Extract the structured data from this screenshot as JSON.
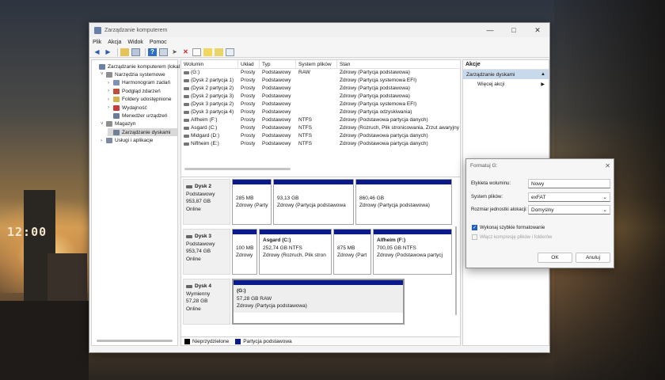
{
  "desktop": {
    "clock": "12:00"
  },
  "window": {
    "title": "Zarządzanie komputerem"
  },
  "menu": [
    "Plik",
    "Akcja",
    "Widok",
    "Pomoc"
  ],
  "tree": [
    {
      "label": "Zarządzanie komputerem (lokal",
      "indent": 0,
      "expander": "",
      "color": "#6b7fa8"
    },
    {
      "label": "Narzędzia systemowe",
      "indent": 1,
      "expander": "˅",
      "color": "#8e8e8e"
    },
    {
      "label": "Harmonogram zadań",
      "indent": 2,
      "expander": "›",
      "color": "#7b93b8"
    },
    {
      "label": "Podgląd zdarzeń",
      "indent": 2,
      "expander": "›",
      "color": "#c0503a"
    },
    {
      "label": "Foldery udostępnione",
      "indent": 2,
      "expander": "›",
      "color": "#d6b24a"
    },
    {
      "label": "Wydajność",
      "indent": 2,
      "expander": "›",
      "color": "#c83c3c"
    },
    {
      "label": "Menedżer urządzeń",
      "indent": 2,
      "expander": "",
      "color": "#6b7b9a"
    },
    {
      "label": "Magazyn",
      "indent": 1,
      "expander": "˅",
      "color": "#8e8e8e"
    },
    {
      "label": "Zarządzanie dyskami",
      "indent": 2,
      "expander": "",
      "color": "#6f7f94",
      "selected": true
    },
    {
      "label": "Usługi i aplikacje",
      "indent": 1,
      "expander": "›",
      "color": "#7d8aa4"
    }
  ],
  "volumes": {
    "headers": [
      "Wolumin",
      "Układ",
      "Typ",
      "System plików",
      "Stan"
    ],
    "rows": [
      [
        "(G:)",
        "Prosty",
        "Podstawowy",
        "RAW",
        "Zdrowy (Partycja podstawowa)"
      ],
      [
        "(Dysk 2 partycja 1)",
        "Prosty",
        "Podstawowy",
        "",
        "Zdrowy (Partycja systemowa EFI)"
      ],
      [
        "(Dysk 2 partycja 2)",
        "Prosty",
        "Podstawowy",
        "",
        "Zdrowy (Partycja podstawowa)"
      ],
      [
        "(Dysk 2 partycja 3)",
        "Prosty",
        "Podstawowy",
        "",
        "Zdrowy (Partycja podstawowa)"
      ],
      [
        "(Dysk 3 partycja 2)",
        "Prosty",
        "Podstawowy",
        "",
        "Zdrowy (Partycja systemowa EFI)"
      ],
      [
        "(Dysk 3 partycja 4)",
        "Prosty",
        "Podstawowy",
        "",
        "Zdrowy (Partycja odzyskiwania)"
      ],
      [
        "Alfheim (F:)",
        "Prosty",
        "Podstawowy",
        "NTFS",
        "Zdrowy (Podstawowa partycja danych)"
      ],
      [
        "Asgard (C:)",
        "Prosty",
        "Podstawowy",
        "NTFS",
        "Zdrowy (Rozruch, Plik stronicowania, Zrzut awaryjny"
      ],
      [
        "Midgard (D:)",
        "Prosty",
        "Podstawowy",
        "NTFS",
        "Zdrowy (Podstawowa partycja danych)"
      ],
      [
        "Niflheim (E:)",
        "Prosty",
        "Podstawowy",
        "NTFS",
        "Zdrowy (Podstawowa partycja danych)"
      ]
    ]
  },
  "disks": [
    {
      "name": "Dysk 2",
      "type": "Podstawowy",
      "size": "953,87 GB",
      "status": "Online",
      "partitions": [
        {
          "label": "",
          "size": "285 MB",
          "status": "Zdrowy (Party"
        },
        {
          "label": "",
          "size": "93,13 GB",
          "status": "Zdrowy (Partycja podstawowa"
        },
        {
          "label": "",
          "size": "860,46 GB",
          "status": "Zdrowy (Partycja podstawowa)"
        }
      ]
    },
    {
      "name": "Dysk 3",
      "type": "Podstawowy",
      "size": "953,74 GB",
      "status": "Online",
      "partitions": [
        {
          "label": "",
          "size": "100 MB",
          "status": "Zdrowy"
        },
        {
          "label": "Asgard (C:)",
          "size": "252,74 GB NTFS",
          "status": "Zdrowy (Rozruch, Plik stron"
        },
        {
          "label": "",
          "size": "875 MB",
          "status": "Zdrowy (Part"
        },
        {
          "label": "Alfheim (F:)",
          "size": "700,05 GB NTFS",
          "status": "Zdrowy (Podstawowa partycj"
        }
      ]
    },
    {
      "name": "Dysk 4",
      "type": "Wymienny",
      "size": "57,28 GB",
      "status": "Online",
      "partitions": [
        {
          "label": "(G:)",
          "size": "57,28 GB RAW",
          "status": "Zdrowy (Partycja podstawowa)"
        }
      ]
    }
  ],
  "legend": [
    {
      "label": "Nieprzydzielone",
      "color": "#000000"
    },
    {
      "label": "Partycja podstawowa",
      "color": "#0b1a8a"
    }
  ],
  "actions": {
    "header": "Akcje",
    "section": "Zarządzanie dyskami",
    "more": "Więcej akcji"
  },
  "dialog": {
    "title": "Formatuj G:",
    "label_label": "Etykieta woluminu:",
    "label_value": "Nowy",
    "fs_label": "System plików:",
    "fs_value": "exFAT",
    "alloc_label": "Rozmiar jednostki alokacji:",
    "alloc_value": "Domyślny",
    "quick_format": "Wykonaj szybkie formatowanie",
    "quick_format_checked": true,
    "compression": "Włącz kompresję plików i folderów",
    "compression_checked": false,
    "ok": "OK",
    "cancel": "Anuluj"
  }
}
